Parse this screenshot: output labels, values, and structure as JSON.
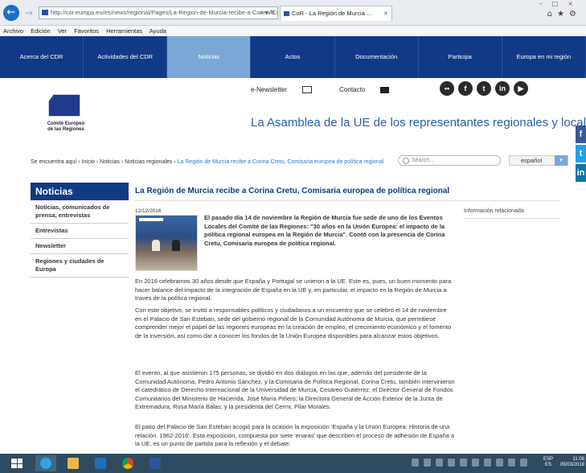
{
  "browser": {
    "url": "http://cor.europa.eu/es/news/regional/Pages/La-Region-de-Murcia-recibe-a-Corina-Cretu",
    "tab_title": "CoR - La Región de Murcia ...",
    "menu": [
      "Archivo",
      "Edición",
      "Ver",
      "Favoritos",
      "Herramientas",
      "Ayuda"
    ]
  },
  "nav": {
    "items": [
      {
        "label": "Acerca del CDR",
        "active": false
      },
      {
        "label": "Actividades del CDR",
        "active": false
      },
      {
        "label": "Noticias",
        "active": true
      },
      {
        "label": "Actos",
        "active": false
      },
      {
        "label": "Documentación",
        "active": false
      },
      {
        "label": "Participa",
        "active": false
      },
      {
        "label": "Europa en mi región",
        "active": false
      }
    ]
  },
  "header": {
    "newsletter": "e-Newsletter",
    "contact": "Contacto",
    "logo_line1": "Comité Europeo",
    "logo_line2": "de las Regiones",
    "tagline": "La Asamblea de la UE de los representantes regionales y locales"
  },
  "breadcrumb": {
    "prefix": "Se encuentra aquí",
    "trail": "Inicio › Noticias › Noticias regionales ›",
    "current": "La Región de Murcia recibe a Corina Cretu, Comisaria europea de política regional"
  },
  "search": {
    "placeholder": "Search..."
  },
  "language": {
    "selected": "español"
  },
  "sidebar": {
    "title": "Noticias",
    "items": [
      {
        "label": "Noticias, comunicados de prensa, entrevistas"
      },
      {
        "label": "Entrevistas"
      },
      {
        "label": "Newsletter"
      },
      {
        "label": "Regiones y ciudades de Europa"
      }
    ]
  },
  "article": {
    "title": "La Región de Murcia recibe a Corina Cretu, Comisaria europea de política regional",
    "date": "12/12/2016",
    "lead": "El pasado día 14 de noviembre la Región de Murcia fue sede de uno de los Eventos Locales del Comité de las Regiones: \"30 años en la Unión Europea: el impacto de la política regional europea en la Región de Murcia\". Contó con la presencia de Corina Cretu, Comisaria europea de política regional.",
    "para1": "En 2016 celebramos 30 años desde que España y Portugal se unieron a la UE. Este es, pues, un buen momento para hacer balance del impacto de la integración de España en la UE y, en particular, el impacto en la Región de Murcia a través de la política regional.",
    "para2": "Con este objetivo, se invitó a responsables políticos y ciudadanos a un encuentro que se celebró el 14 de noviembre en el Palacio de San Esteban, sede del gobierno regional de la Comunidad Autónoma de Murcia, que permitiese comprender mejor el papel de las regiones europeas en la creación de empleo, el crecimiento económico y el fomento de la inversión, así como dar a conocer los fondos de la Unión Europea disponibles para alcanzar estos objetivos.",
    "para3": "El evento, al que asistieron 175 personas, se dividió en dos diálogos en las que, además del presidente de la Comunidad Autónoma, Pedro Antonio Sánchez, y la Comisaria de Política Regional, Corina Cretu, también intervinieron el catedrático de Derecho Internacional de la Universidad de Murcia, Cesáreo Gutiérrez; el Director General de Fondos Comunitarios del Ministerio de Hacienda, José María Piñero; la Directora General de Acción Exterior de la Junta de Extremadura, Rosa María Balas; y la presidenta del Cermi, Pilar Morales.",
    "para4": "El patio del Palacio de San Esteban acogió para la ocasión la exposición 'España y la Unión Europea: Historia de una relación. 1962-2016'. Esta exposición, compuesta por siete 'enaras' que describen el proceso de adhesión de España a la UE, es un punto de partida para la reflexión y el debate."
  },
  "related": {
    "title": "Información relacionada"
  },
  "taskbar": {
    "lang": "ESP",
    "lang_sub": "ES",
    "time": "11:08",
    "date": "05/03/2018"
  },
  "colors": {
    "nav_bg": "#113a86",
    "nav_active": "#7aa7d5",
    "link": "#2b7bd0"
  }
}
